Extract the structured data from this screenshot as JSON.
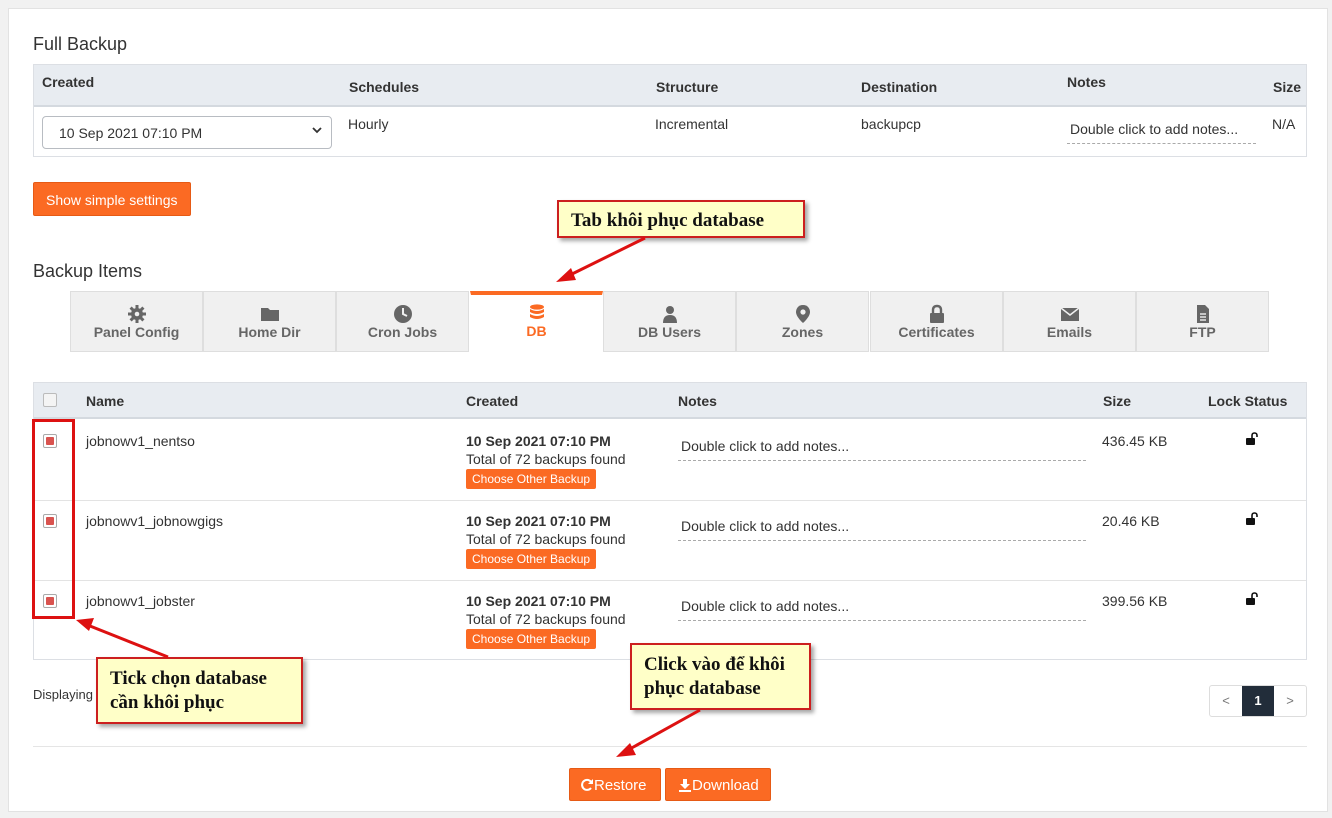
{
  "full_backup": {
    "title": "Full Backup",
    "headers": {
      "created": "Created",
      "schedules": "Schedules",
      "structure": "Structure",
      "destination": "Destination",
      "notes": "Notes",
      "size": "Size"
    },
    "created_value": "10 Sep 2021 07:10 PM",
    "schedules": "Hourly",
    "structure": "Incremental",
    "destination": "backupcp",
    "notes_placeholder": "Double click to add notes...",
    "size": "N/A"
  },
  "show_simple_settings_label": "Show simple settings",
  "backup_items": {
    "title": "Backup Items",
    "tabs": [
      {
        "label": "Panel Config",
        "icon": "gear-icon"
      },
      {
        "label": "Home Dir",
        "icon": "folder-icon"
      },
      {
        "label": "Cron Jobs",
        "icon": "clock-icon"
      },
      {
        "label": "DB",
        "icon": "database-icon",
        "active": true
      },
      {
        "label": "DB Users",
        "icon": "user-icon"
      },
      {
        "label": "Zones",
        "icon": "map-pin-icon"
      },
      {
        "label": "Certificates",
        "icon": "lock-icon"
      },
      {
        "label": "Emails",
        "icon": "envelope-icon"
      },
      {
        "label": "FTP",
        "icon": "file-icon"
      }
    ]
  },
  "db_table": {
    "headers": {
      "name": "Name",
      "created": "Created",
      "notes": "Notes",
      "size": "Size",
      "lock_status": "Lock Status"
    },
    "rows": [
      {
        "name": "jobnowv1_nentso",
        "created": "10 Sep 2021 07:10 PM",
        "total": "Total of 72 backups found",
        "choose": "Choose Other Backup",
        "notes": "Double click to add notes...",
        "size": "436.45 KB",
        "checked": true
      },
      {
        "name": "jobnowv1_jobnowgigs",
        "created": "10 Sep 2021 07:10 PM",
        "total": "Total of 72 backups found",
        "choose": "Choose Other Backup",
        "notes": "Double click to add notes...",
        "size": "20.46 KB",
        "checked": true
      },
      {
        "name": "jobnowv1_jobster",
        "created": "10 Sep 2021 07:10 PM",
        "total": "Total of 72 backups found",
        "choose": "Choose Other Backup",
        "notes": "Double click to add notes...",
        "size": "399.56 KB",
        "checked": true
      }
    ]
  },
  "displaying_label": "Displaying",
  "pagination": {
    "prev": "<",
    "current": "1",
    "next": ">"
  },
  "actions": {
    "restore": "Restore",
    "download": "Download"
  },
  "annotations": {
    "tab_callout": "Tab khôi phục database",
    "tick_callout_line1": "Tick chọn database",
    "tick_callout_line2": "cần khôi phục",
    "click_callout_line1": "Click vào để khôi",
    "click_callout_line2": "phục database"
  },
  "colors": {
    "accent": "#fb6a23",
    "annotation_red": "#cc1f1f",
    "callout_bg": "#ffffc8",
    "header_bg": "#e8ecf1"
  }
}
